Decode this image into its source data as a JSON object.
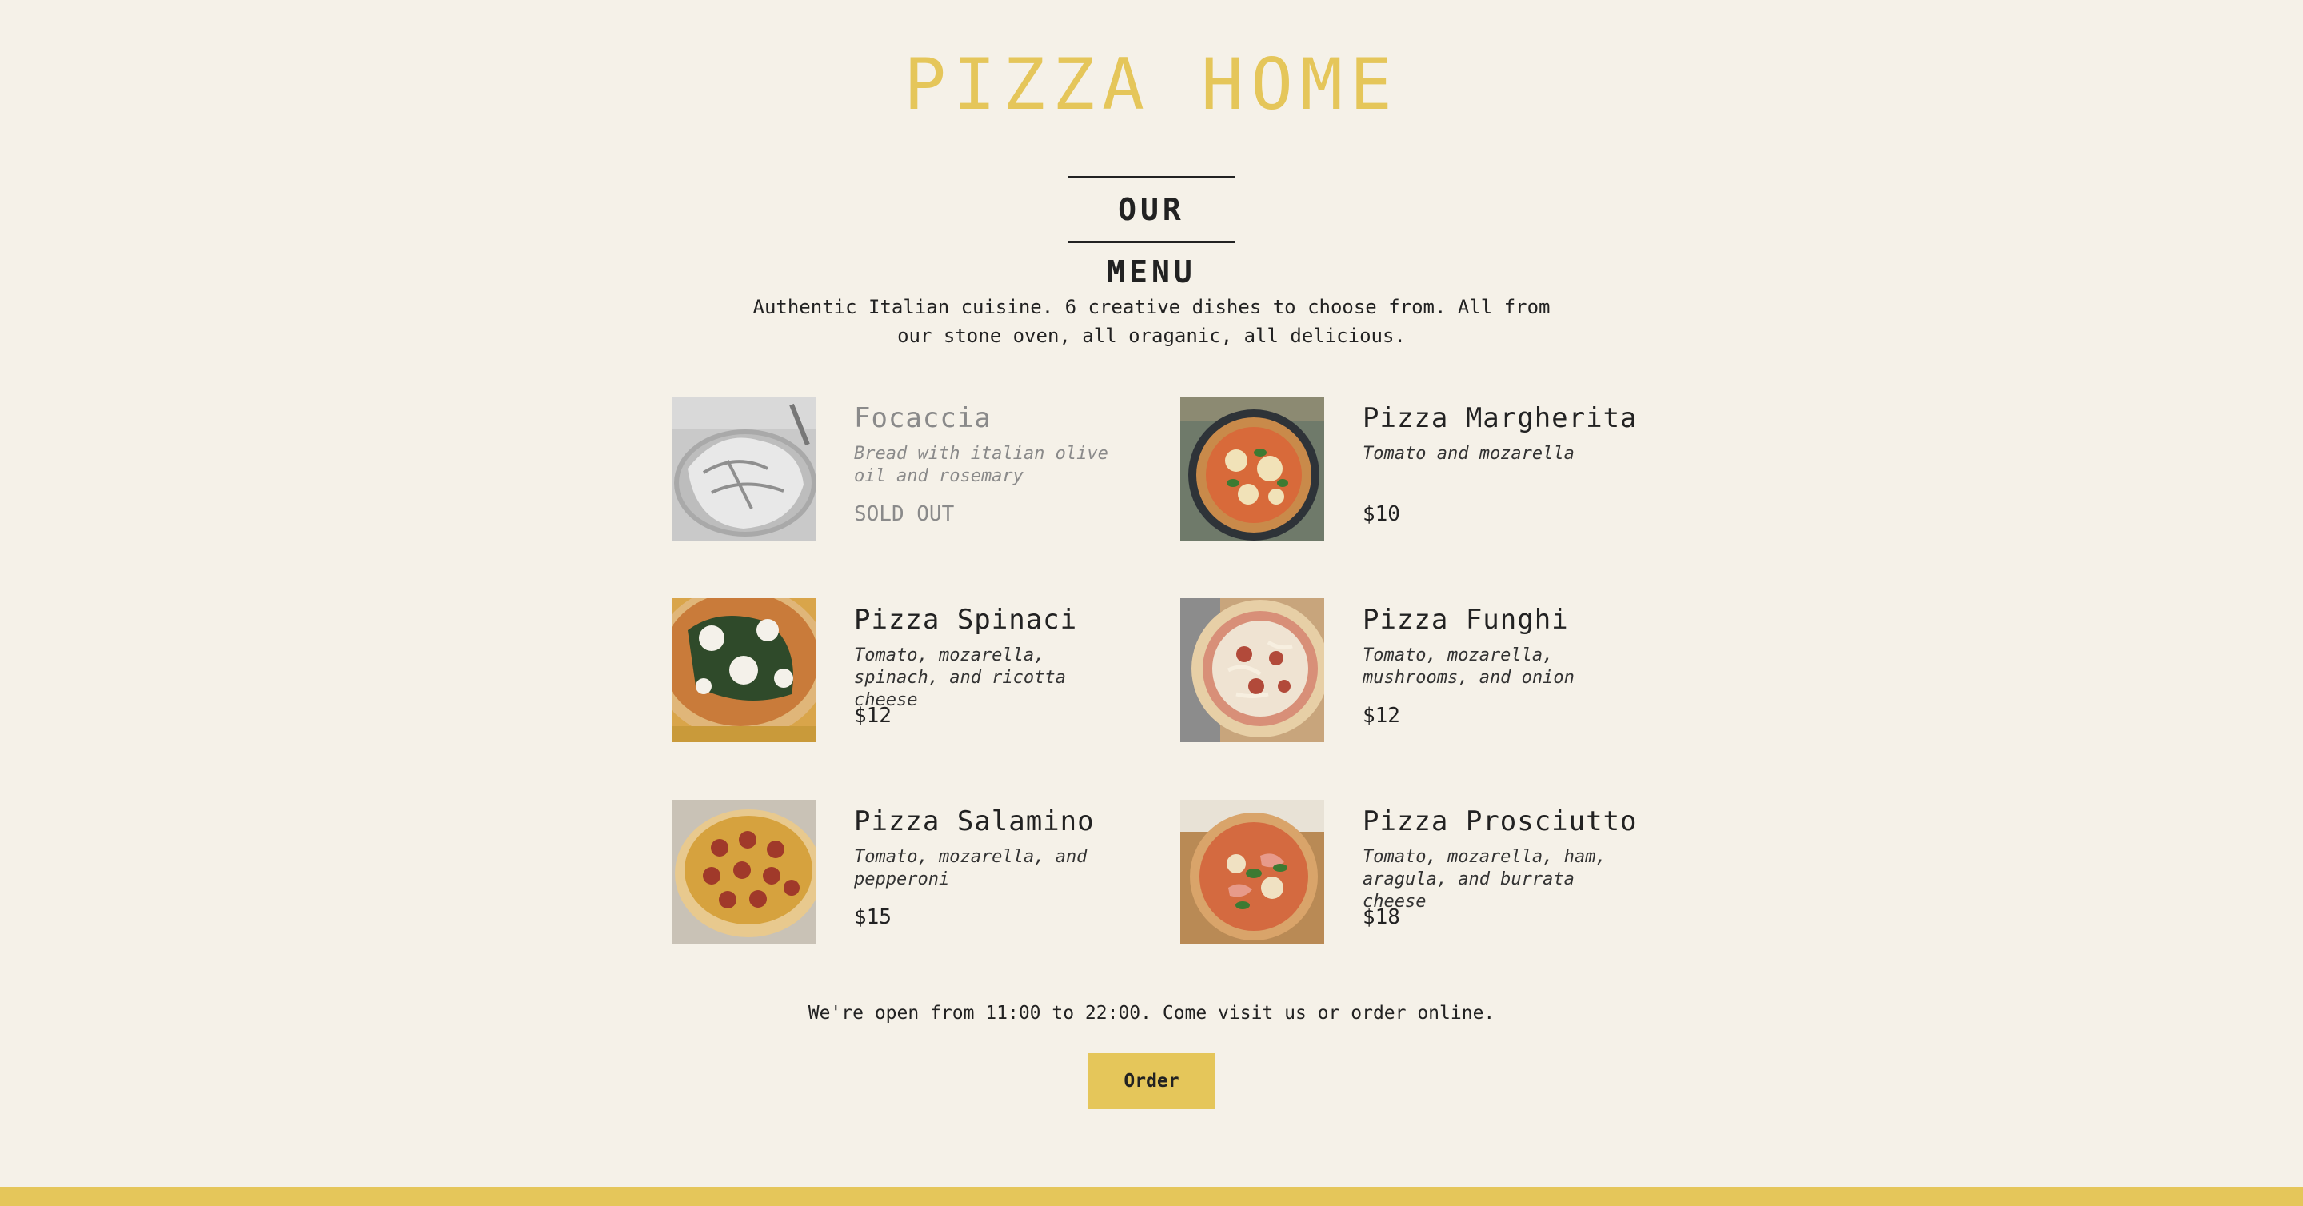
{
  "header": {
    "brand": "PIZZA HOME"
  },
  "menu": {
    "heading": "OUR MENU",
    "intro_line1": "Authentic Italian cuisine. 6 creative dishes to choose from. All from",
    "intro_line2": "our stone oven, all oraganic, all delicious.",
    "items": [
      {
        "name": "Focaccia",
        "desc": "Bread with italian olive oil and rosemary",
        "price": "SOLD OUT",
        "sold_out": true
      },
      {
        "name": "Pizza Margherita",
        "desc": "Tomato and mozarella",
        "price": "$10",
        "sold_out": false
      },
      {
        "name": "Pizza Spinaci",
        "desc": "Tomato, mozarella, spinach, and ricotta cheese",
        "price": "$12",
        "sold_out": false
      },
      {
        "name": "Pizza Funghi",
        "desc": "Tomato, mozarella, mushrooms, and onion",
        "price": "$12",
        "sold_out": false
      },
      {
        "name": "Pizza Salamino",
        "desc": "Tomato, mozarella, and pepperoni",
        "price": "$15",
        "sold_out": false
      },
      {
        "name": "Pizza Prosciutto",
        "desc": "Tomato, mozarella, ham, aragula, and burrata cheese",
        "price": "$18",
        "sold_out": false
      }
    ]
  },
  "footer": {
    "hours": "We're open from 11:00 to 22:00. Come visit us or order online.",
    "order_label": "Order"
  },
  "colors": {
    "background": "#f5f1e8",
    "accent": "#e5c65a",
    "text": "#222222",
    "sold_out_text": "#8a8a8a"
  }
}
